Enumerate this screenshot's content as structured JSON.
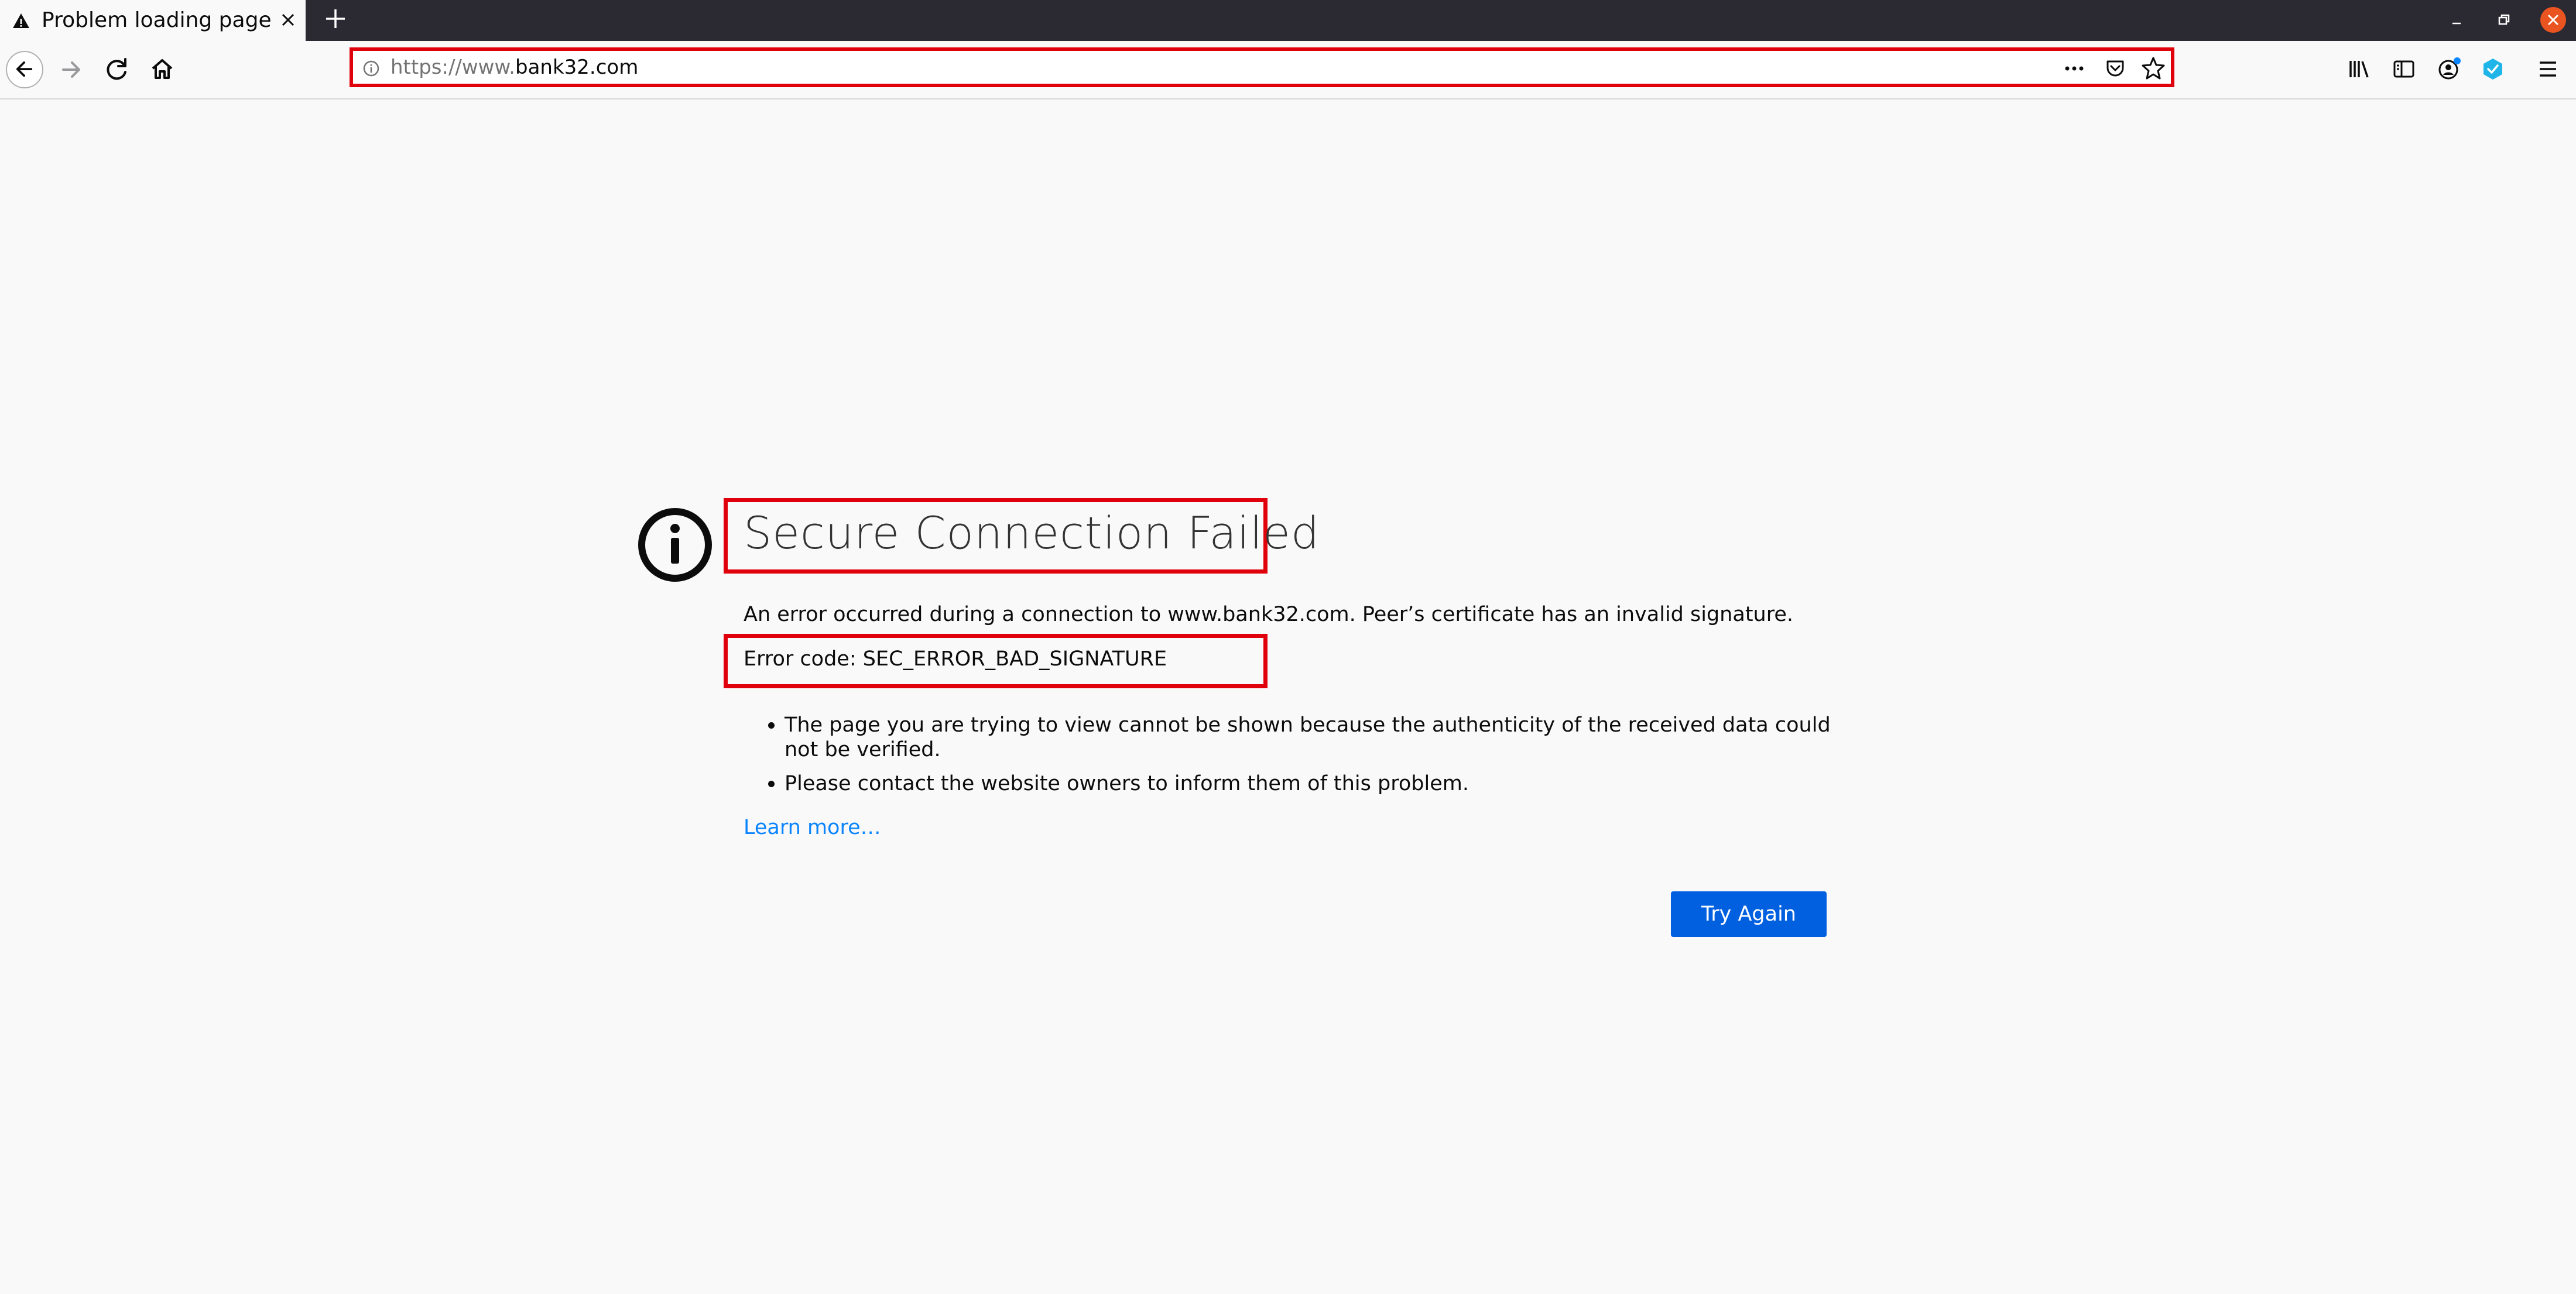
{
  "browser": {
    "tab": {
      "title": "Problem loading page",
      "icon": "warning-icon"
    },
    "url": {
      "prefix": "https://www.",
      "host": "bank32.com"
    },
    "colors": {
      "tabstrip": "#2b2a33",
      "highlight": "#e0000b",
      "close_button": "#e95420",
      "link": "#0a84ff",
      "primary_button": "#0060df"
    }
  },
  "error_page": {
    "title": "Secure Connection Failed",
    "description": "An error occurred during a connection to www.bank32.com. Peer’s certificate has an invalid signature.",
    "error_code": "Error code: SEC_ERROR_BAD_SIGNATURE",
    "bullets": [
      "The page you are trying to view cannot be shown because the authenticity of the received data could not be verified.",
      "Please contact the website owners to inform them of this problem."
    ],
    "learn_more": "Learn more…",
    "try_again": "Try Again"
  }
}
